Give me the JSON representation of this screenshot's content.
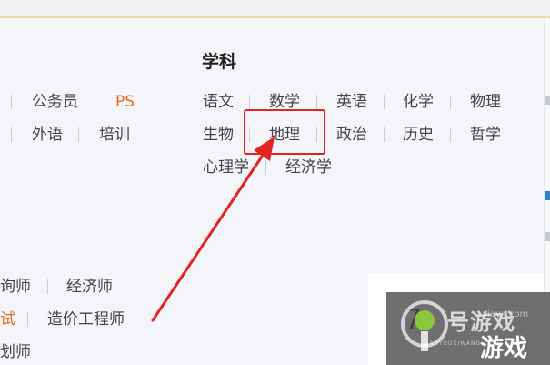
{
  "subjects": {
    "title": "学科",
    "items": [
      "语文",
      "数学",
      "英语",
      "化学",
      "物理",
      "生物",
      "地理",
      "政治",
      "历史",
      "哲学",
      "心理学",
      "经济学"
    ]
  },
  "left_categories": {
    "row1": [
      "公务员",
      "PS"
    ],
    "row2": [
      "外语",
      "培训"
    ]
  },
  "exams": {
    "row1": [
      "询师",
      "经济师"
    ],
    "row2": [
      "试",
      "造价工程师"
    ],
    "row3": "划师"
  },
  "card": {
    "number": "7"
  },
  "watermark": {
    "title": "号游戏",
    "site": "xiayx.com",
    "pinyin": "HAOYOUXIWANG",
    "game": "游戏"
  },
  "colors": {
    "accent_orange": "#e86a1c",
    "highlight_red": "#e32222"
  }
}
